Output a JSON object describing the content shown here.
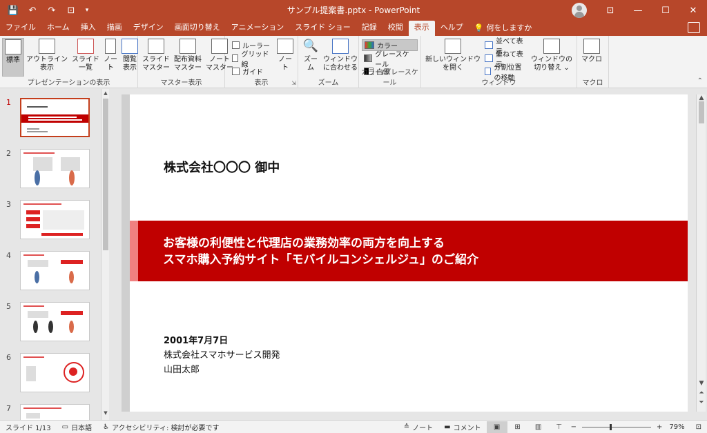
{
  "window": {
    "title": "サンプル提案書.pptx  -  PowerPoint",
    "minimize": "—",
    "maximize": "☐",
    "close": "✕",
    "ribbon_display": "⊡"
  },
  "qat": {
    "save_icon": "💾",
    "undo_icon": "↶",
    "redo_icon": "↷",
    "present_icon": "⊡",
    "more_icon": "▾"
  },
  "tabs": [
    {
      "label": "ファイル"
    },
    {
      "label": "ホーム"
    },
    {
      "label": "挿入"
    },
    {
      "label": "描画"
    },
    {
      "label": "デザイン"
    },
    {
      "label": "画面切り替え"
    },
    {
      "label": "アニメーション"
    },
    {
      "label": "スライド ショー"
    },
    {
      "label": "記録"
    },
    {
      "label": "校閲"
    },
    {
      "label": "表示"
    },
    {
      "label": "ヘルプ"
    }
  ],
  "tell_me": "何をしますか",
  "ribbon": {
    "presentation_views": {
      "label": "プレゼンテーションの表示",
      "normal": "標準",
      "outline": "アウトライン\n表示",
      "sorter": "スライド\n一覧",
      "notes": "ノー\nト",
      "reading": "閲覧表示"
    },
    "master_views": {
      "label": "マスター表示",
      "slide_master": "スライド\nマスター",
      "handout_master": "配布資料\nマスター",
      "notes_master": "ノート\nマスター"
    },
    "show": {
      "label": "表示",
      "ruler": "ルーラー",
      "gridlines": "グリッド線",
      "guides": "ガイド",
      "notes": "ノー\nト"
    },
    "zoom": {
      "label": "ズーム",
      "zoom": "ズーム",
      "fit": "ウィンドウ\nに合わせる"
    },
    "color": {
      "label": "カラー/グレースケール",
      "color": "カラー",
      "grayscale": "グレースケール",
      "bw": "白黒"
    },
    "window": {
      "label": "ウィンドウ",
      "new_window": "新しいウィンドウ\nを開く",
      "arrange_all": "並べて表示",
      "cascade": "重ねて表示",
      "move_split": "分割位置の移動",
      "switch_windows": "ウィンドウの\n切り替え ⌄"
    },
    "macros": {
      "label": "マクロ",
      "macros": "マクロ"
    }
  },
  "slides": [
    {
      "num": "1"
    },
    {
      "num": "2"
    },
    {
      "num": "3"
    },
    {
      "num": "4"
    },
    {
      "num": "5"
    },
    {
      "num": "6"
    },
    {
      "num": "7"
    }
  ],
  "slide": {
    "company": "株式会社〇〇〇 御中",
    "title_line1": "お客様の利便性と代理店の業務効率の両方を向上する",
    "title_line2": "スマホ購入予約サイト「モバイルコンシェルジュ」のご紹介",
    "date": "2001年7月7日",
    "presenter_company": "株式会社スマホサービス開発",
    "presenter_name": "山田太郎"
  },
  "status": {
    "slide_counter": "スライド 1/13",
    "language": "日本語",
    "accessibility": "アクセシビリティ: 検討が必要です",
    "notes": "ノート",
    "comments": "コメント",
    "zoom_minus": "−",
    "zoom_plus": "+",
    "zoom_level": "79%",
    "zoom_fraction": 0.4
  },
  "colors": {
    "accent": "#b7472a",
    "slide_band": "#c00000",
    "band_accent": "#f08080"
  }
}
